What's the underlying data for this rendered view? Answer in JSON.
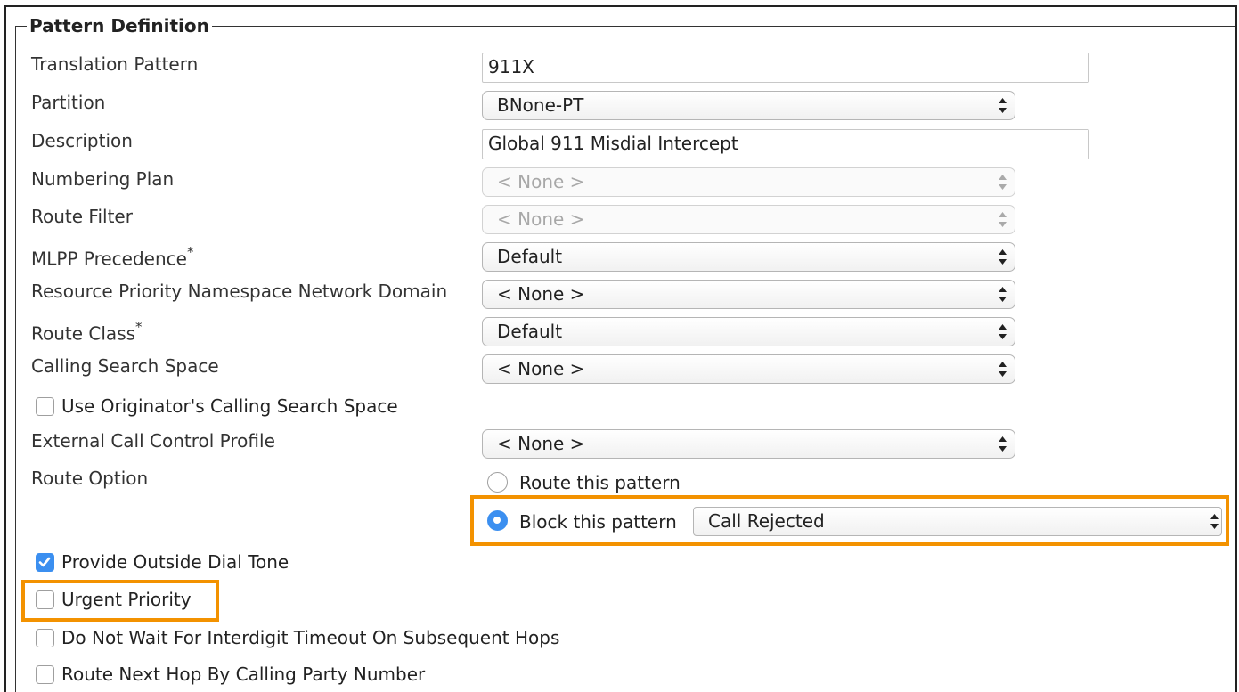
{
  "section": {
    "legend": "Pattern Definition"
  },
  "fields": {
    "translation_pattern": {
      "label": "Translation Pattern",
      "value": "911X"
    },
    "partition": {
      "label": "Partition",
      "value": "BNone-PT"
    },
    "description": {
      "label": "Description",
      "value": "Global 911 Misdial Intercept"
    },
    "numbering_plan": {
      "label": "Numbering Plan",
      "value": "< None >",
      "disabled": true
    },
    "route_filter": {
      "label": "Route Filter",
      "value": "< None >",
      "disabled": true
    },
    "mlpp_precedence": {
      "label": "MLPP Precedence",
      "required_mark": "*",
      "value": "Default"
    },
    "resource_priority": {
      "label": "Resource Priority Namespace Network Domain",
      "value": "< None >"
    },
    "route_class": {
      "label": "Route Class",
      "required_mark": "*",
      "value": "Default"
    },
    "calling_search_space": {
      "label": "Calling Search Space",
      "value": "< None >"
    },
    "external_call_control": {
      "label": "External Call Control Profile",
      "value": "< None >"
    },
    "route_option": {
      "label": "Route Option",
      "route_label": "Route this pattern",
      "block_label": "Block this pattern",
      "selected": "block",
      "block_reason": "Call Rejected"
    }
  },
  "checkboxes": {
    "use_originator_css": {
      "label": "Use Originator's Calling Search Space",
      "checked": false
    },
    "provide_outside_dial_tone": {
      "label": "Provide Outside Dial Tone",
      "checked": true
    },
    "urgent_priority": {
      "label": "Urgent Priority",
      "checked": false
    },
    "do_not_wait": {
      "label": "Do Not Wait For Interdigit Timeout On Subsequent Hops",
      "checked": false
    },
    "route_next_hop": {
      "label": "Route Next Hop By Calling Party Number",
      "checked": false
    }
  },
  "colors": {
    "highlight": "#f39200",
    "accent": "#3b8ff0"
  }
}
